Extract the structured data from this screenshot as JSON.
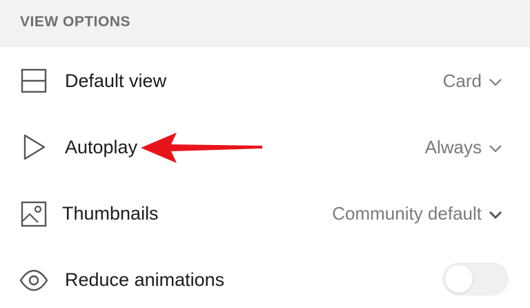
{
  "section": {
    "title": "VIEW OPTIONS"
  },
  "rows": [
    {
      "icon": "layout-icon",
      "label": "Default view",
      "value": "Card"
    },
    {
      "icon": "play-icon",
      "label": "Autoplay",
      "value": "Always"
    },
    {
      "icon": "image-icon",
      "label": "Thumbnails",
      "value": "Community default"
    },
    {
      "icon": "eye-icon",
      "label": "Reduce animations",
      "toggle_on": false
    }
  ],
  "colors": {
    "header_bg": "#f2f2f2",
    "label_text": "#1c1c1c",
    "value_text": "#7a7a7a",
    "icon_stroke": "#555555",
    "annotation_arrow": "#e8141c"
  }
}
